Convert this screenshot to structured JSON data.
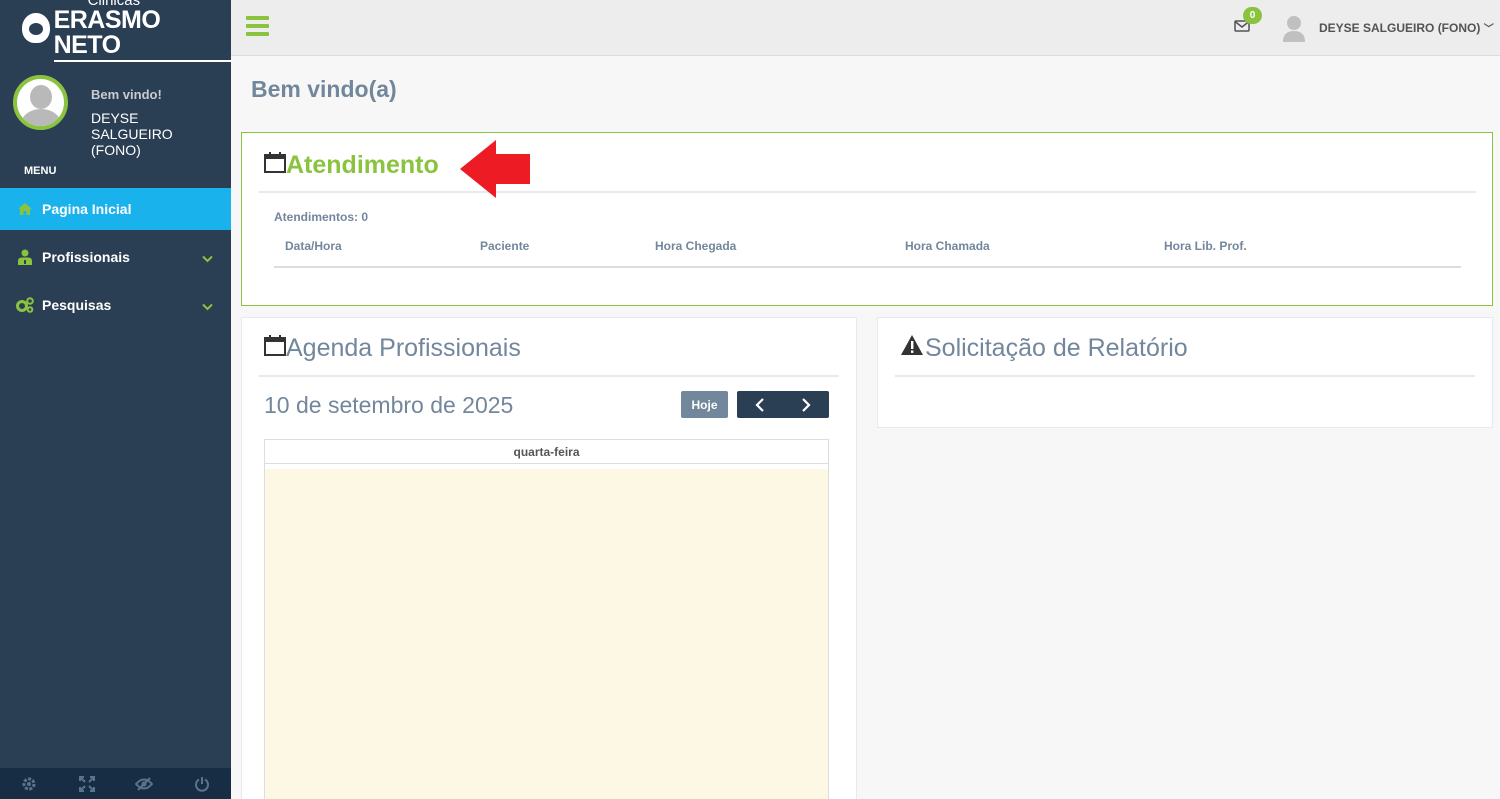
{
  "brand": {
    "small": "Clinicas",
    "big": "ERASMO NETO"
  },
  "profile": {
    "welcome": "Bem vindo!",
    "name": "DEYSE SALGUEIRO (FONO)"
  },
  "sidebar": {
    "menu_label": "MENU",
    "items": [
      {
        "label": "Pagina Inicial",
        "icon": "home-icon",
        "active": true
      },
      {
        "label": "Profissionais",
        "icon": "user-md-icon",
        "active": false
      },
      {
        "label": "Pesquisas",
        "icon": "cogs-icon",
        "active": false
      }
    ],
    "footer": [
      "settings-icon",
      "fullscreen-icon",
      "eye-slash-icon",
      "power-icon"
    ]
  },
  "topbar": {
    "mail_count": "0",
    "user_name": "DEYSE SALGUEIRO (FONO)"
  },
  "page": {
    "title": "Bem vindo(a)"
  },
  "atendimento": {
    "title": "Atendimento",
    "count_label": "Atendimentos: 0",
    "columns": [
      "Data/Hora",
      "Paciente",
      "Hora Chegada",
      "Hora Chamada",
      "Hora Lib. Prof."
    ]
  },
  "agenda": {
    "title": "Agenda Profissionais",
    "date": "10 de setembro de 2025",
    "today_button": "Hoje",
    "day_header": "quarta-feira"
  },
  "relatorio": {
    "title": "Solicitação de Relatório"
  },
  "colors": {
    "sidebar": "#2a3f54",
    "accent_green": "#8ac43f",
    "active_blue": "#1ab2ec",
    "text_gray": "#73879c",
    "arrow_red": "#ed1c24"
  }
}
